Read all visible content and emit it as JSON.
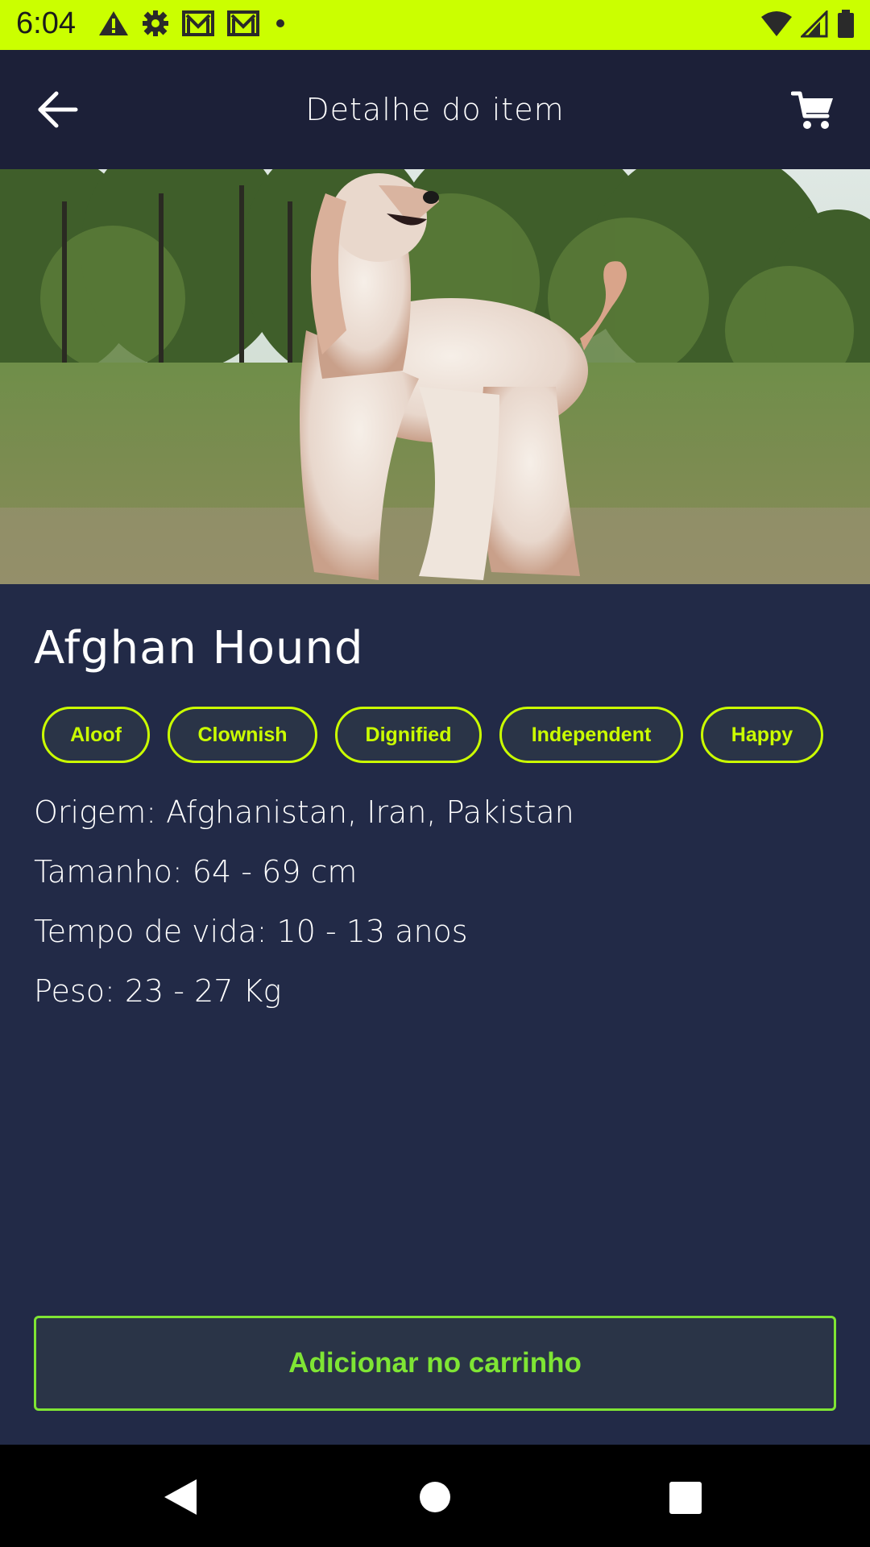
{
  "status_bar": {
    "time": "6:04",
    "background": "#cbff00",
    "left_icons": [
      "warning-icon",
      "settings-icon",
      "gmail-icon",
      "gmail-icon",
      "dot-icon"
    ],
    "right_icons": [
      "wifi-icon",
      "signal-icon",
      "battery-icon"
    ]
  },
  "app_bar": {
    "title": "Detalhe do item",
    "back_icon": "arrow-left-icon",
    "cart_icon": "shopping-cart-icon",
    "background": "#1c2038"
  },
  "item": {
    "name": "Afghan Hound",
    "image_alt": "Afghan Hound",
    "temperaments": [
      "Aloof",
      "Clownish",
      "Dignified",
      "Independent",
      "Happy"
    ],
    "origin": "Origem: Afghanistan, Iran, Pakistan",
    "size": "Tamanho: 64 - 69 cm",
    "life_span": "Tempo de vida: 10 - 13 anos",
    "weight": "Peso: 23 - 27 Kg"
  },
  "actions": {
    "add_to_cart": "Adicionar no carrinho"
  },
  "nav_bar": {
    "icons": [
      "back-triangle-icon",
      "home-circle-icon",
      "recents-square-icon"
    ]
  },
  "colors": {
    "accent": "#cbff00",
    "button_accent": "#7fe534",
    "background": "#222a47"
  }
}
